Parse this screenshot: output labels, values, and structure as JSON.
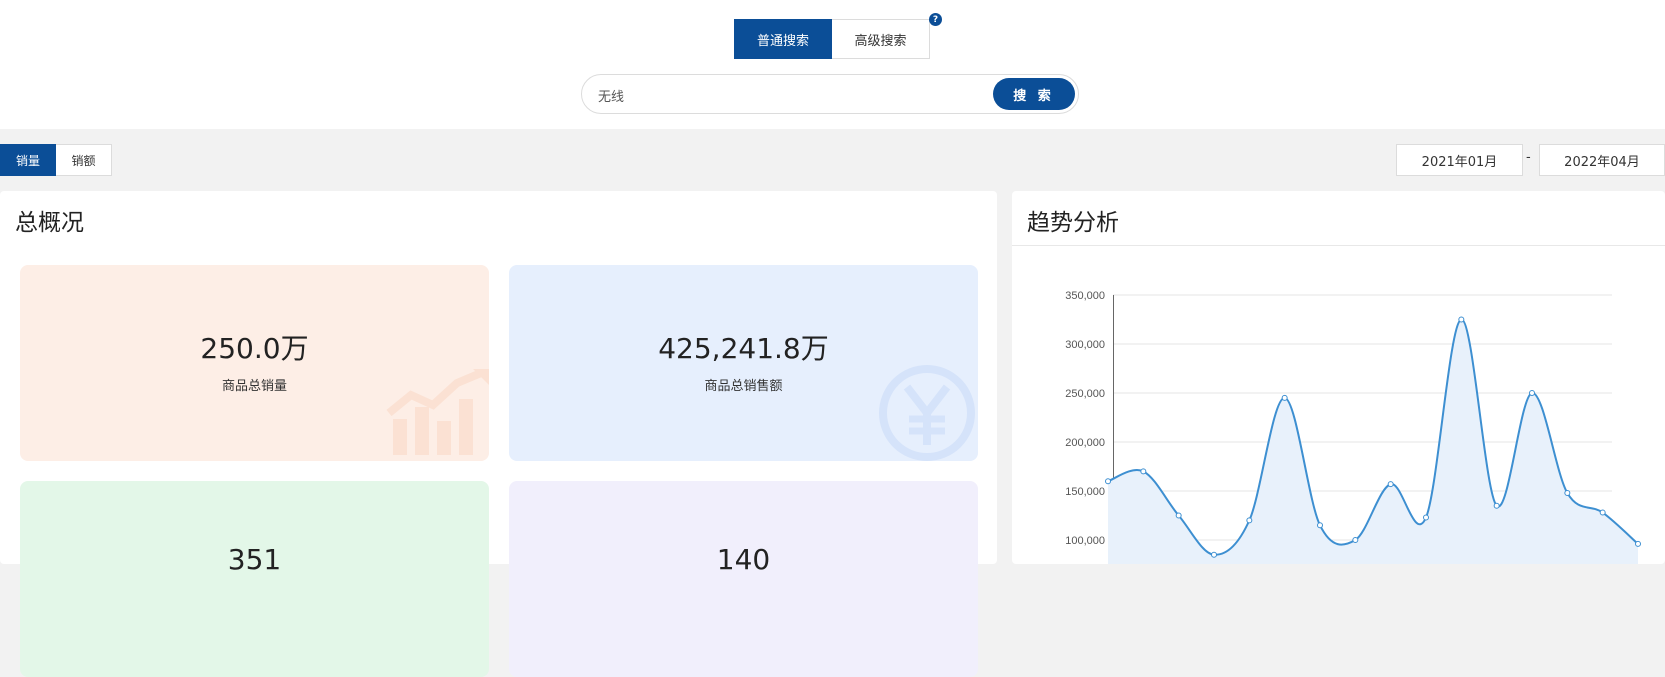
{
  "search": {
    "tabs": [
      {
        "label": "普通搜索",
        "active": true
      },
      {
        "label": "高级搜索",
        "active": false
      }
    ],
    "help_symbol": "?",
    "query": "无线",
    "button_label": "搜 索"
  },
  "metric_toggle": [
    {
      "label": "销量",
      "active": true
    },
    {
      "label": "销额",
      "active": false
    }
  ],
  "date_range": {
    "start": "2021年01月",
    "separator": "-",
    "end": "2022年04月"
  },
  "overview": {
    "title": "总概况",
    "tiles": [
      {
        "value": "250.0万",
        "label": "商品总销量",
        "bg": "#fdeee6",
        "icon": "growth-chart-icon"
      },
      {
        "value": "425,241.8万",
        "label": "商品总销售额",
        "bg": "#e6effd",
        "icon": "yen-icon"
      },
      {
        "value": "351",
        "label": "",
        "bg": "#e3f7e8",
        "icon": ""
      },
      {
        "value": "140",
        "label": "",
        "bg": "#f1effc",
        "icon": ""
      }
    ]
  },
  "trend": {
    "title": "趋势分析"
  },
  "chart_data": {
    "type": "area",
    "title": "趋势分析",
    "ylim": [
      100000,
      350000
    ],
    "yticks": [
      "350,000",
      "300,000",
      "250,000",
      "200,000",
      "150,000",
      "100,000"
    ],
    "series": [
      {
        "values": [
          160000,
          170000,
          125000,
          85000,
          120000,
          245000,
          115000,
          100000,
          157000,
          123000,
          325000,
          135000,
          250000,
          148000,
          128000,
          96000
        ]
      }
    ],
    "color": "#3d8fd1",
    "fill": "#e8f1fb",
    "grid": true
  }
}
